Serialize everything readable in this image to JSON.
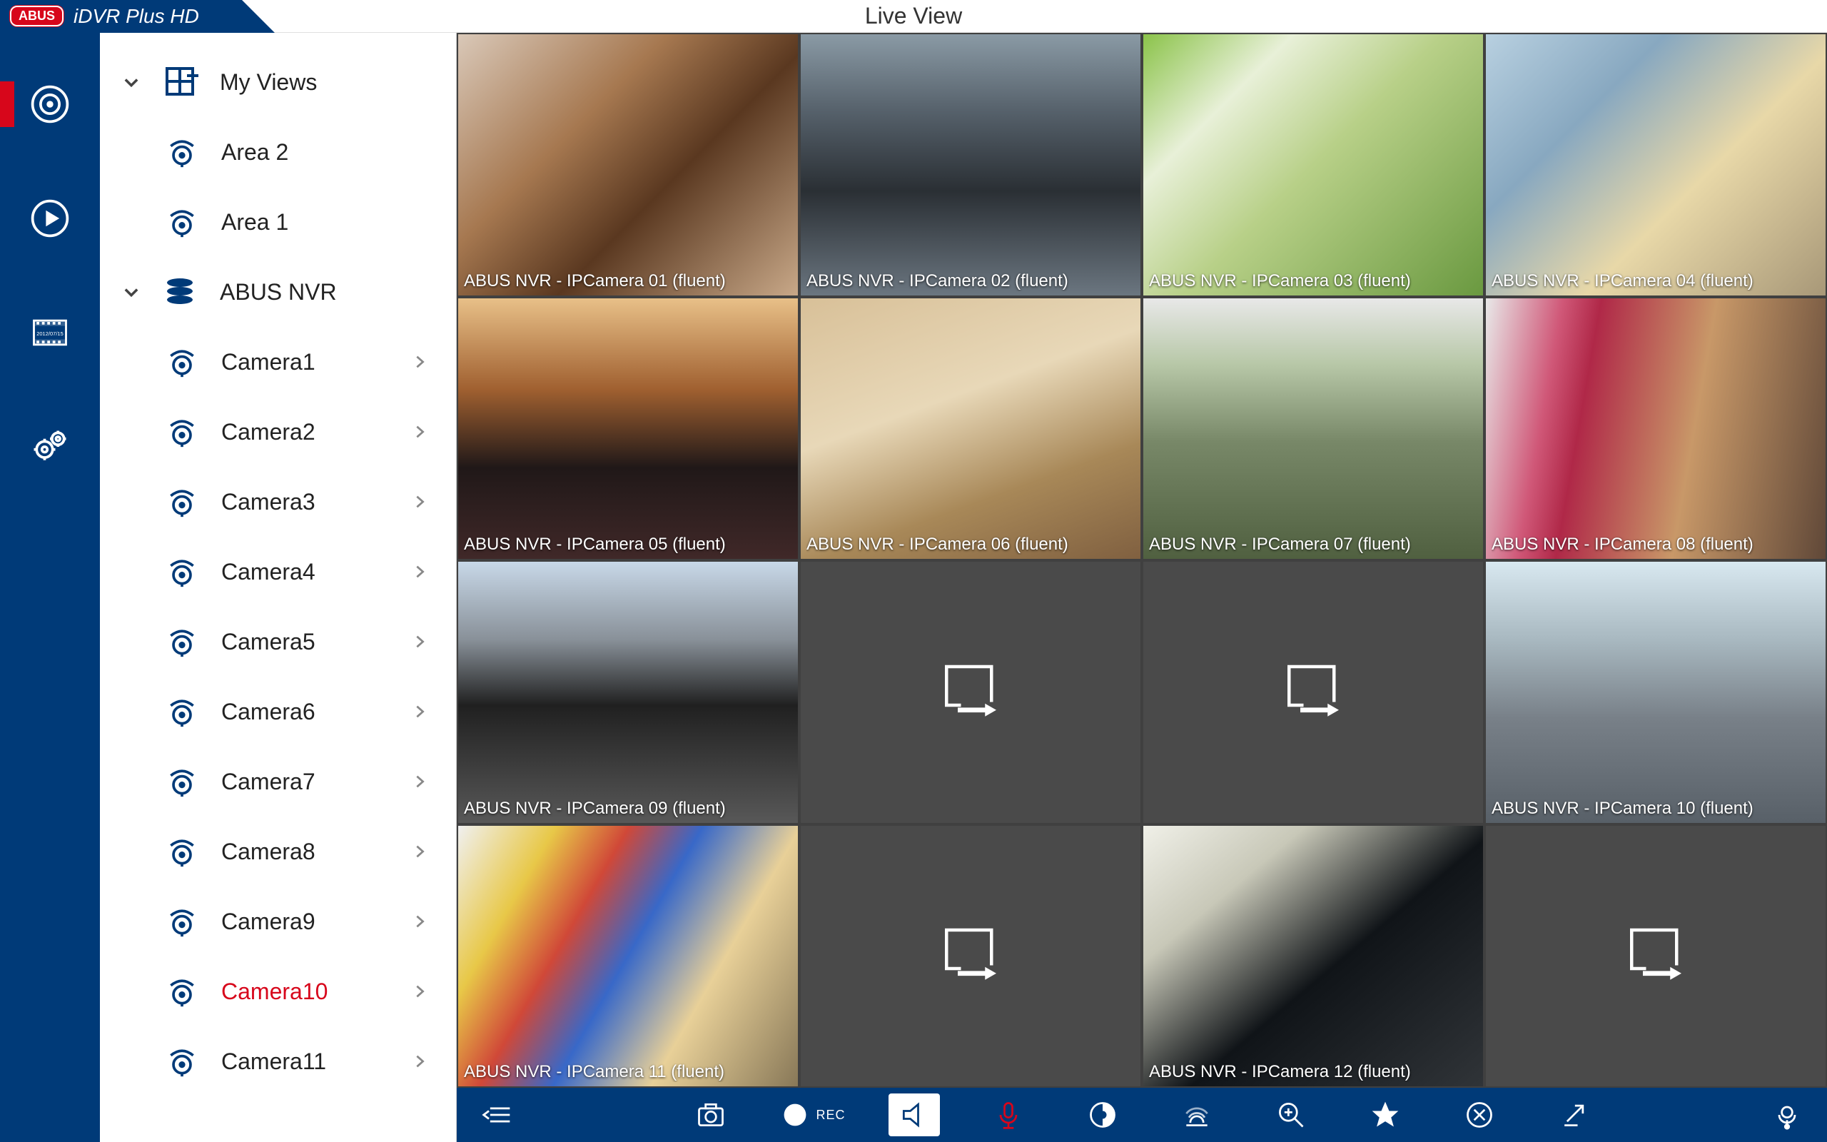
{
  "header": {
    "brand_badge": "ABUS",
    "brand_name": "iDVR Plus HD",
    "title": "Live View"
  },
  "rail": {
    "items": [
      {
        "name": "live-view",
        "active": true
      },
      {
        "name": "playback",
        "active": false
      },
      {
        "name": "recordings",
        "active": false
      },
      {
        "name": "settings",
        "active": false
      }
    ],
    "recordings_date": "2012/07/15"
  },
  "sidebar": {
    "groups": [
      {
        "name": "my-views",
        "label": "My Views",
        "icon": "views-icon",
        "expanded": true,
        "children": [
          {
            "name": "area-2",
            "label": "Area 2",
            "icon": "camera-icon",
            "chevron": false
          },
          {
            "name": "area-1",
            "label": "Area 1",
            "icon": "camera-icon",
            "chevron": false
          }
        ]
      },
      {
        "name": "abus-nvr",
        "label": "ABUS NVR",
        "icon": "server-icon",
        "expanded": true,
        "children": [
          {
            "name": "camera1",
            "label": "Camera1",
            "icon": "camera-icon",
            "chevron": true,
            "selected": false
          },
          {
            "name": "camera2",
            "label": "Camera2",
            "icon": "camera-icon",
            "chevron": true,
            "selected": false
          },
          {
            "name": "camera3",
            "label": "Camera3",
            "icon": "camera-icon",
            "chevron": true,
            "selected": false
          },
          {
            "name": "camera4",
            "label": "Camera4",
            "icon": "camera-icon",
            "chevron": true,
            "selected": false
          },
          {
            "name": "camera5",
            "label": "Camera5",
            "icon": "camera-icon",
            "chevron": true,
            "selected": false
          },
          {
            "name": "camera6",
            "label": "Camera6",
            "icon": "camera-icon",
            "chevron": true,
            "selected": false
          },
          {
            "name": "camera7",
            "label": "Camera7",
            "icon": "camera-icon",
            "chevron": true,
            "selected": false
          },
          {
            "name": "camera8",
            "label": "Camera8",
            "icon": "camera-icon",
            "chevron": true,
            "selected": false
          },
          {
            "name": "camera9",
            "label": "Camera9",
            "icon": "camera-icon",
            "chevron": true,
            "selected": false
          },
          {
            "name": "camera10",
            "label": "Camera10",
            "icon": "camera-icon",
            "chevron": true,
            "selected": true
          },
          {
            "name": "camera11",
            "label": "Camera11",
            "icon": "camera-icon",
            "chevron": true,
            "selected": false
          }
        ]
      }
    ]
  },
  "grid": {
    "tiles": [
      {
        "caption": "ABUS NVR - IPCamera 01 (fluent)",
        "empty": false,
        "feed": "feed-1"
      },
      {
        "caption": "ABUS NVR - IPCamera 02 (fluent)",
        "empty": false,
        "feed": "feed-2"
      },
      {
        "caption": "ABUS NVR - IPCamera 03 (fluent)",
        "empty": false,
        "feed": "feed-3"
      },
      {
        "caption": "ABUS NVR - IPCamera 04 (fluent)",
        "empty": false,
        "feed": "feed-4"
      },
      {
        "caption": "ABUS NVR - IPCamera 05 (fluent)",
        "empty": false,
        "feed": "feed-5"
      },
      {
        "caption": "ABUS NVR - IPCamera 06 (fluent)",
        "empty": false,
        "feed": "feed-6"
      },
      {
        "caption": "ABUS NVR - IPCamera 07 (fluent)",
        "empty": false,
        "feed": "feed-7"
      },
      {
        "caption": "ABUS NVR - IPCamera 08 (fluent)",
        "empty": false,
        "feed": "feed-8"
      },
      {
        "caption": "ABUS NVR - IPCamera 09 (fluent)",
        "empty": false,
        "feed": "feed-9"
      },
      {
        "caption": "",
        "empty": true,
        "feed": ""
      },
      {
        "caption": "",
        "empty": true,
        "feed": ""
      },
      {
        "caption": "ABUS NVR - IPCamera 10 (fluent)",
        "empty": false,
        "feed": "feed-10"
      },
      {
        "caption": "ABUS NVR - IPCamera 11 (fluent)",
        "empty": false,
        "feed": "feed-11"
      },
      {
        "caption": "",
        "empty": true,
        "feed": ""
      },
      {
        "caption": "ABUS NVR - IPCamera 12 (fluent)",
        "empty": false,
        "feed": "feed-12"
      },
      {
        "caption": "",
        "empty": true,
        "feed": ""
      }
    ]
  },
  "toolbar": {
    "rec_label": "REC",
    "buttons": [
      "collapse",
      "snapshot",
      "record",
      "speaker",
      "microphone",
      "iris",
      "alarm",
      "zoom",
      "favorite",
      "close",
      "fullscreen",
      "ptz"
    ],
    "active": "speaker"
  },
  "colors": {
    "brand_blue": "#003a78",
    "brand_red": "#d7061b",
    "tile_bg": "#4a4a4a"
  }
}
